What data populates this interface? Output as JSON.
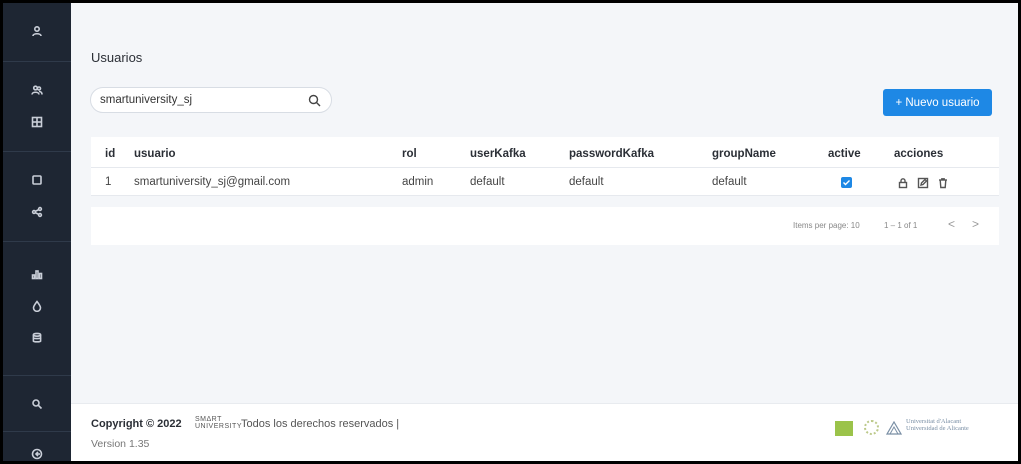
{
  "sidebar": {
    "icons": [
      "user-icon",
      "users-icon",
      "grid-icon",
      "square-icon",
      "share-icon",
      "bar-chart-icon",
      "drop-icon",
      "database-icon",
      "search-person-icon",
      "logout-icon"
    ]
  },
  "page": {
    "title": "Usuarios"
  },
  "search": {
    "value": "smartuniversity_sj",
    "icon": "search-icon"
  },
  "toolbar": {
    "new_user_label": "+ Nuevo usuario"
  },
  "table": {
    "headers": {
      "id": "id",
      "usuario": "usuario",
      "rol": "rol",
      "userKafka": "userKafka",
      "passwordKafka": "passwordKafka",
      "groupName": "groupName",
      "active": "active",
      "acciones": "acciones"
    },
    "rows": [
      {
        "id": "1",
        "usuario": "smartuniversity_sj@gmail.com",
        "rol": "admin",
        "userKafka": "default",
        "passwordKafka": "default",
        "groupName": "default",
        "active": true,
        "actions": [
          "lock-icon",
          "edit-icon",
          "delete-icon"
        ]
      }
    ]
  },
  "paginator": {
    "items_per_page": "Items per page: 10",
    "range": "1 – 1 of 1",
    "prev": "<",
    "next": ">"
  },
  "footer": {
    "copyright": "Copyright © 2022",
    "brand_line1": "SMΔRT",
    "brand_line2": "UNIVERSITY",
    "rights": "Todos los derechos reservados |",
    "version": "Version 1.35",
    "ua_line1": "Universitat d'Alacant",
    "ua_line2": "Universidad de Alicante"
  },
  "colors": {
    "sidebar_bg": "#1e2633",
    "accent": "#1e88e5",
    "page_bg": "#f4f6f9"
  }
}
